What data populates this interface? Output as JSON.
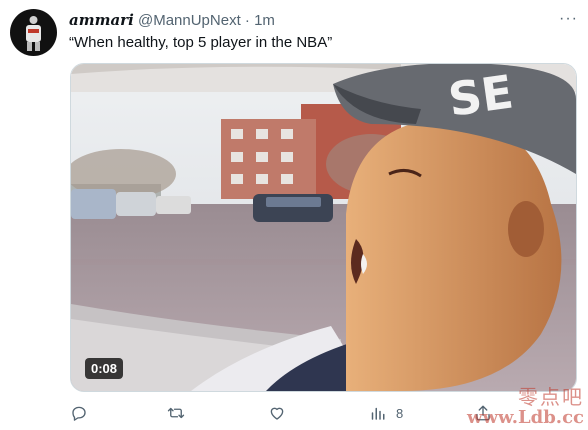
{
  "tweet": {
    "display_name": "ammari",
    "handle": "@MannUpNext",
    "separator": "·",
    "time": "1m",
    "text": "“When healthy, top 5 player in the NBA”",
    "more_icon": "more-horizontal-icon"
  },
  "media": {
    "duration": "0:08",
    "cap_text": "SE"
  },
  "actions": {
    "reply_icon": "reply-icon",
    "retweet_icon": "retweet-icon",
    "like_icon": "heart-icon",
    "views_icon": "views-icon",
    "views_count": "8",
    "share_icon": "share-icon"
  },
  "watermark": {
    "chinese": "零点吧",
    "url": "www.Ldb.cc"
  },
  "colors": {
    "text": "#0f1419",
    "muted": "#536471",
    "border": "#cfd9de",
    "watermark": "#c0392b"
  }
}
